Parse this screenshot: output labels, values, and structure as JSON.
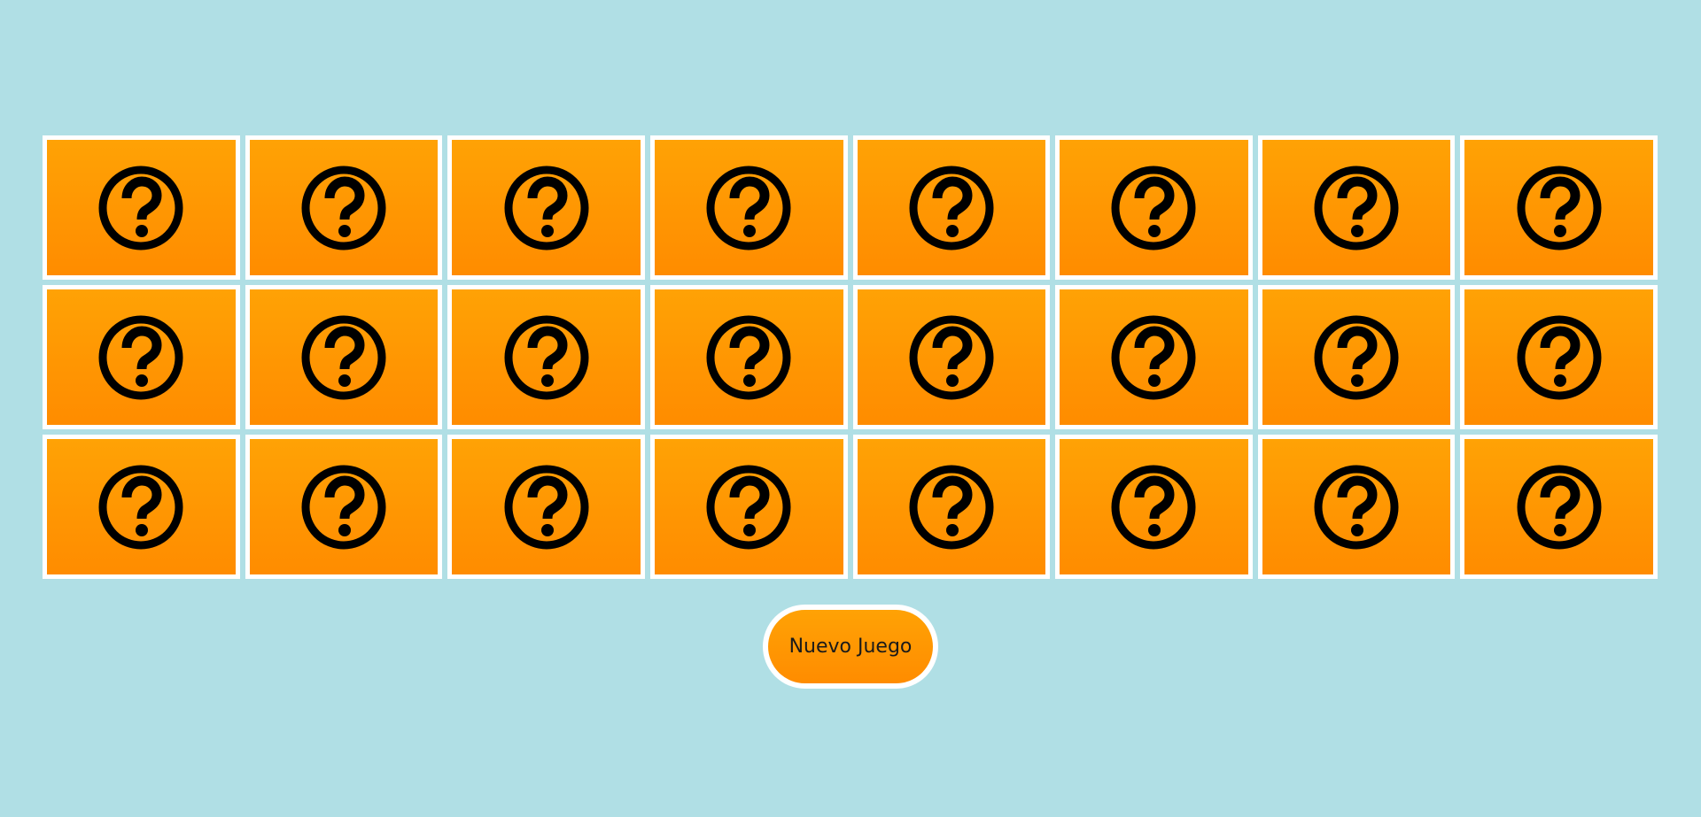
{
  "board": {
    "rows": 3,
    "columns": 8,
    "card_face": "question-mark-icon",
    "card_color": "#ff9800",
    "border_color": "#ffffff"
  },
  "controls": {
    "new_game_label": "Nuevo Juego"
  },
  "colors": {
    "background": "#b0dfe5",
    "accent": "#ff9800"
  }
}
